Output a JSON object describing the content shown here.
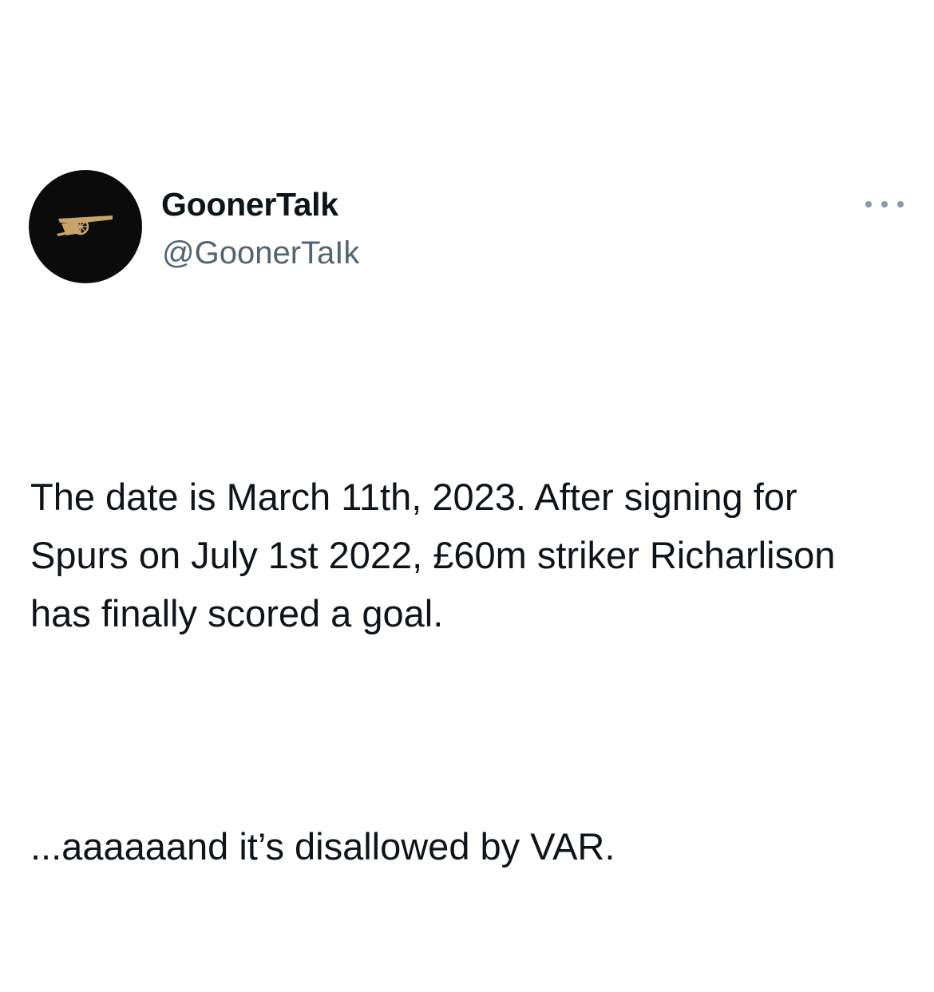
{
  "author": {
    "display_name": "GoonerTalk",
    "handle": "@GoonerTaIk",
    "avatar_icon": "arsenal-cannon-icon"
  },
  "menu": {
    "more_icon": "more-horizontal-icon"
  },
  "tweet": {
    "paragraphs": [
      "The date is March 11th, 2023. After signing for Spurs on July 1st 2022, £60m striker Richarlison has finally scored a goal.",
      "...aaaaaand it’s disallowed by VAR."
    ]
  },
  "colors": {
    "text": "#0f1419",
    "secondary_text": "#536471",
    "avatar_bg": "#0b0b0b",
    "cannon": "#c9a46a",
    "more_dots": "#8b98a5"
  }
}
